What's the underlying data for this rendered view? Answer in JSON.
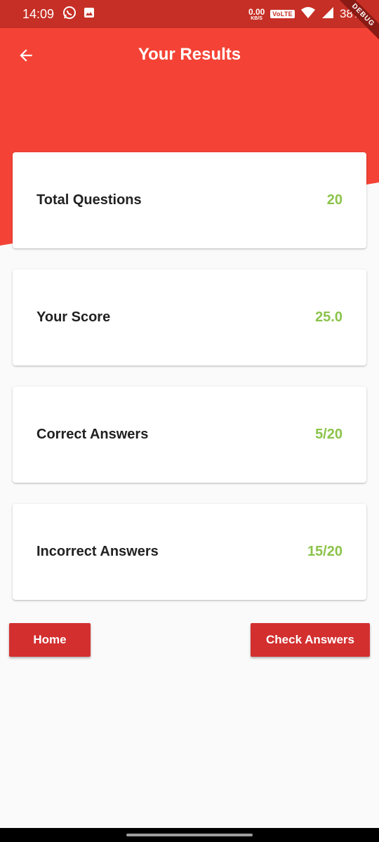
{
  "status_bar": {
    "time": "14:09",
    "net_speed_value": "0.00",
    "net_speed_unit": "KB/S",
    "volte": "VoLTE",
    "battery": "38%",
    "icons": [
      "whatsapp-icon",
      "image-icon",
      "wifi-icon",
      "signal-icon"
    ]
  },
  "debug_banner": "DEBUG",
  "appbar": {
    "title": "Your Results",
    "back_icon": "arrow-back-icon"
  },
  "results": [
    {
      "label": "Total Questions",
      "value": "20"
    },
    {
      "label": "Your Score",
      "value": "25.0"
    },
    {
      "label": "Correct Answers",
      "value": "5/20"
    },
    {
      "label": "Incorrect Answers",
      "value": "15/20"
    }
  ],
  "buttons": {
    "home": "Home",
    "check_answers": "Check Answers"
  },
  "colors": {
    "primary": "#f44336",
    "status_bar": "#c62f25",
    "button": "#d32f2f",
    "value_green": "#8bc34a",
    "background": "#fafafa"
  }
}
